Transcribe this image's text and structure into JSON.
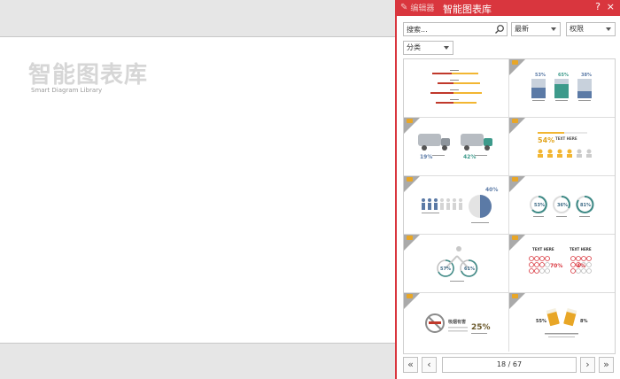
{
  "slide": {
    "title": "智能图表库",
    "subtitle": "Smart Diagram Library"
  },
  "pane": {
    "edit_label": "编辑器",
    "title": "智能图表库",
    "help": "?",
    "close": "×",
    "search_placeholder": "搜索...",
    "sort_value": "最新",
    "permission_value": "权限",
    "category_value": "分类"
  },
  "thumbs": {
    "percent_54": "54%",
    "text_here": "TEXT HERE",
    "cars_19": "19%",
    "cars_42": "42%",
    "bld_1": "53%",
    "bld_2": "65%",
    "bld_3": "38%",
    "people_pct": "40%",
    "ring_1": "53%",
    "ring_2": "36%",
    "ring_3": "81%",
    "bike_1": "57%",
    "bike_2": "61%",
    "smile_title_1": "TEXT HERE",
    "smile_title_2": "TEXT HERE",
    "smile_pct_1": "70%",
    "smile_pct_2": "4%",
    "smoke_pct": "25%",
    "smoke_label": "吸烟有害",
    "beer_1": "55%",
    "beer_2": "8%"
  },
  "pager": {
    "first": "«",
    "prev": "‹",
    "page_text": "18 / 67",
    "next": "›",
    "last": "»"
  },
  "colors": {
    "accent": "#d9363e",
    "crown": "#e8a626",
    "steel": "#5b7aa6",
    "teal": "#3d9a8b",
    "gold": "#f2b632"
  }
}
